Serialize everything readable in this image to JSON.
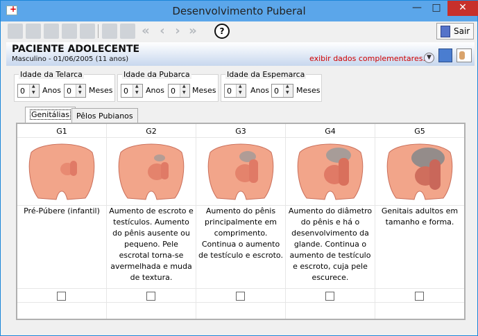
{
  "window": {
    "title": "Desenvolvimento Puberal",
    "minimize": "—",
    "maximize": "□",
    "close": "✕"
  },
  "toolbar": {
    "help": "?",
    "exit_label": "Sair"
  },
  "patient": {
    "name": "PACIENTE ADOLECENTE",
    "info": "Masculino - 01/06/2005 (11 anos)",
    "more_link": "exibir dados complementares...",
    "expand": "▼"
  },
  "ages": [
    {
      "legend": "Idade da Telarca",
      "years": "0",
      "years_unit": "Anos",
      "months": "0",
      "months_unit": "Meses"
    },
    {
      "legend": "Idade da Pubarca",
      "years": "0",
      "years_unit": "Anos",
      "months": "0",
      "months_unit": "Meses"
    },
    {
      "legend": "Idade da Espemarca",
      "years": "0",
      "years_unit": "Anos",
      "months": "0",
      "months_unit": "Meses"
    }
  ],
  "tabs": [
    {
      "label": "Genitálias"
    },
    {
      "label": "Pêlos Pubianos"
    }
  ],
  "stages": [
    {
      "label": "G1",
      "description": "Pré-Púbere (infantil)"
    },
    {
      "label": "G2",
      "description": "Aumento de escroto e testículos. Aumento do pênis ausente ou pequeno. Pele escrotal torna-se avermelhada e muda de textura."
    },
    {
      "label": "G3",
      "description": "Aumento do pênis principalmente em comprimento. Continua o aumento de testículo e escroto."
    },
    {
      "label": "G4",
      "description": "Aumento do diâmetro do pênis e há o desenvolvimento da glande. Continua o aumento de testículo e escroto, cuja pele escurece."
    },
    {
      "label": "G5",
      "description": "Genitais adultos em tamanho e forma."
    }
  ],
  "colors": {
    "skin": "#f2a58a",
    "skin_dark": "#e07a66",
    "hair": "#9a9a9a",
    "title_bar": "#5ba6ea",
    "link": "#d00000"
  }
}
